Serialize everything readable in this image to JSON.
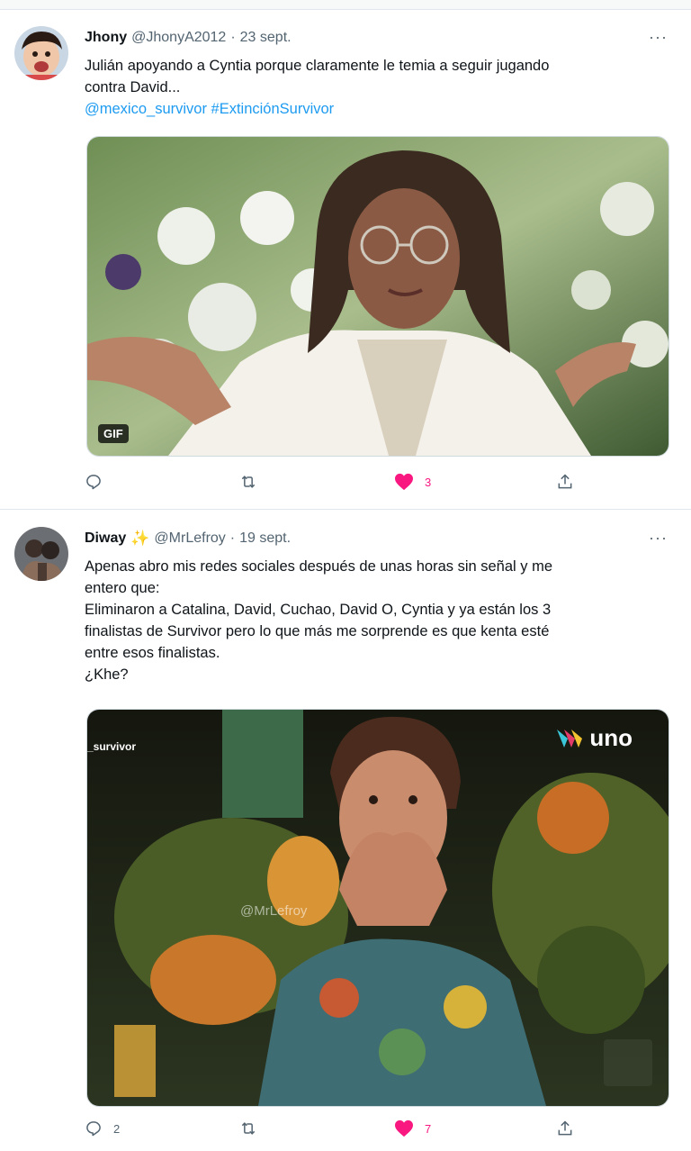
{
  "tweets": [
    {
      "display_name": "Jhony",
      "handle": "@JhonyA2012",
      "separator": "·",
      "time": "23 sept.",
      "more": "···",
      "text_lines": [
        "Julián apoyando a Cyntia porque claramente le temia a seguir jugando",
        "contra David..."
      ],
      "hashtags": "@mexico_survivor #ExtinciónSurvivor",
      "media": {
        "badge": "GIF"
      },
      "actions": {
        "reply_count": "",
        "retweet_count": "",
        "like_count": "3",
        "liked": true
      }
    },
    {
      "display_name": "Diway",
      "emoji": "✨",
      "handle": "@MrLefroy",
      "separator": "·",
      "time": "19 sept.",
      "more": "···",
      "text_lines": [
        "Apenas abro mis redes sociales después de unas horas sin señal y me",
        "entero que:",
        "Eliminaron a Catalina, David, Cuchao, David O, Cyntia y ya están los 3",
        "finalistas de Survivor pero lo que más me sorprende es que kenta esté",
        "entre esos finalistas.",
        "¿Khe?"
      ],
      "media": {
        "network_logo": "uno",
        "source_tag": "_survivor",
        "watermark": "@MrLefroy"
      },
      "actions": {
        "reply_count": "2",
        "retweet_count": "",
        "like_count": "7",
        "liked": true
      }
    }
  ],
  "colors": {
    "link": "#1d9bf0",
    "like": "#f91880",
    "muted": "#536471"
  }
}
